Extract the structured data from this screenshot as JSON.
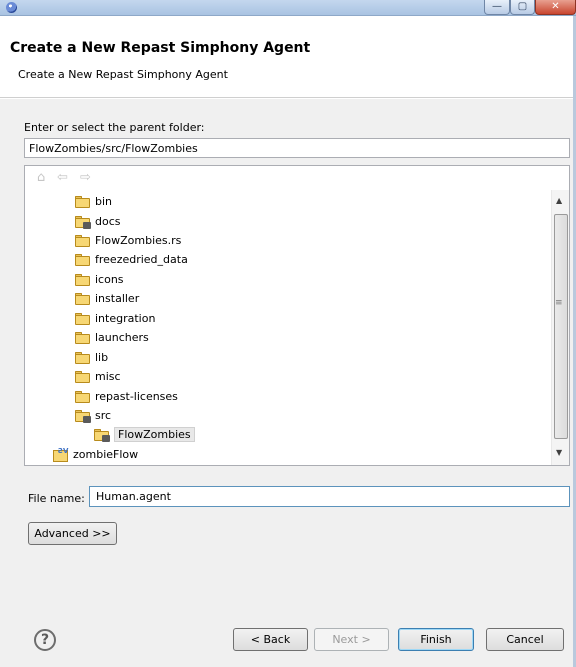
{
  "window": {
    "minimize_icon": "minimize-icon",
    "maximize_icon": "maximize-icon",
    "close_icon": "close-icon",
    "minimize_glyph": "—",
    "maximize_glyph": "▢",
    "close_glyph": "✕"
  },
  "header": {
    "title": "Create a New Repast Simphony Agent",
    "subtitle": "Create a New Repast Simphony Agent"
  },
  "folder": {
    "label": "Enter or select the parent folder:",
    "value": "FlowZombies/src/FlowZombies"
  },
  "tree_toolbar": {
    "home_glyph": "⌂",
    "back_glyph": "⇦",
    "forward_glyph": "⇨"
  },
  "tree": {
    "items": [
      {
        "label": "bin",
        "icon": "open-folder-icon"
      },
      {
        "label": "docs",
        "icon": "package-folder-icon"
      },
      {
        "label": "FlowZombies.rs",
        "icon": "folder-icon"
      },
      {
        "label": "freezedried_data",
        "icon": "folder-icon"
      },
      {
        "label": "icons",
        "icon": "folder-icon"
      },
      {
        "label": "installer",
        "icon": "folder-icon"
      },
      {
        "label": "integration",
        "icon": "folder-icon"
      },
      {
        "label": "launchers",
        "icon": "folder-icon"
      },
      {
        "label": "lib",
        "icon": "folder-icon"
      },
      {
        "label": "misc",
        "icon": "folder-icon"
      },
      {
        "label": "repast-licenses",
        "icon": "folder-icon"
      },
      {
        "label": "src",
        "icon": "package-folder-icon"
      },
      {
        "label": "FlowZombies",
        "icon": "package-folder-icon",
        "selected": true
      },
      {
        "label": "zombieFlow",
        "icon": "project-icon"
      }
    ]
  },
  "filename": {
    "label": "File name:",
    "value": "Human.agent"
  },
  "buttons": {
    "advanced": "Advanced >>",
    "back": "< Back",
    "next": "Next >",
    "finish": "Finish",
    "cancel": "Cancel"
  },
  "help": {
    "glyph": "?"
  }
}
